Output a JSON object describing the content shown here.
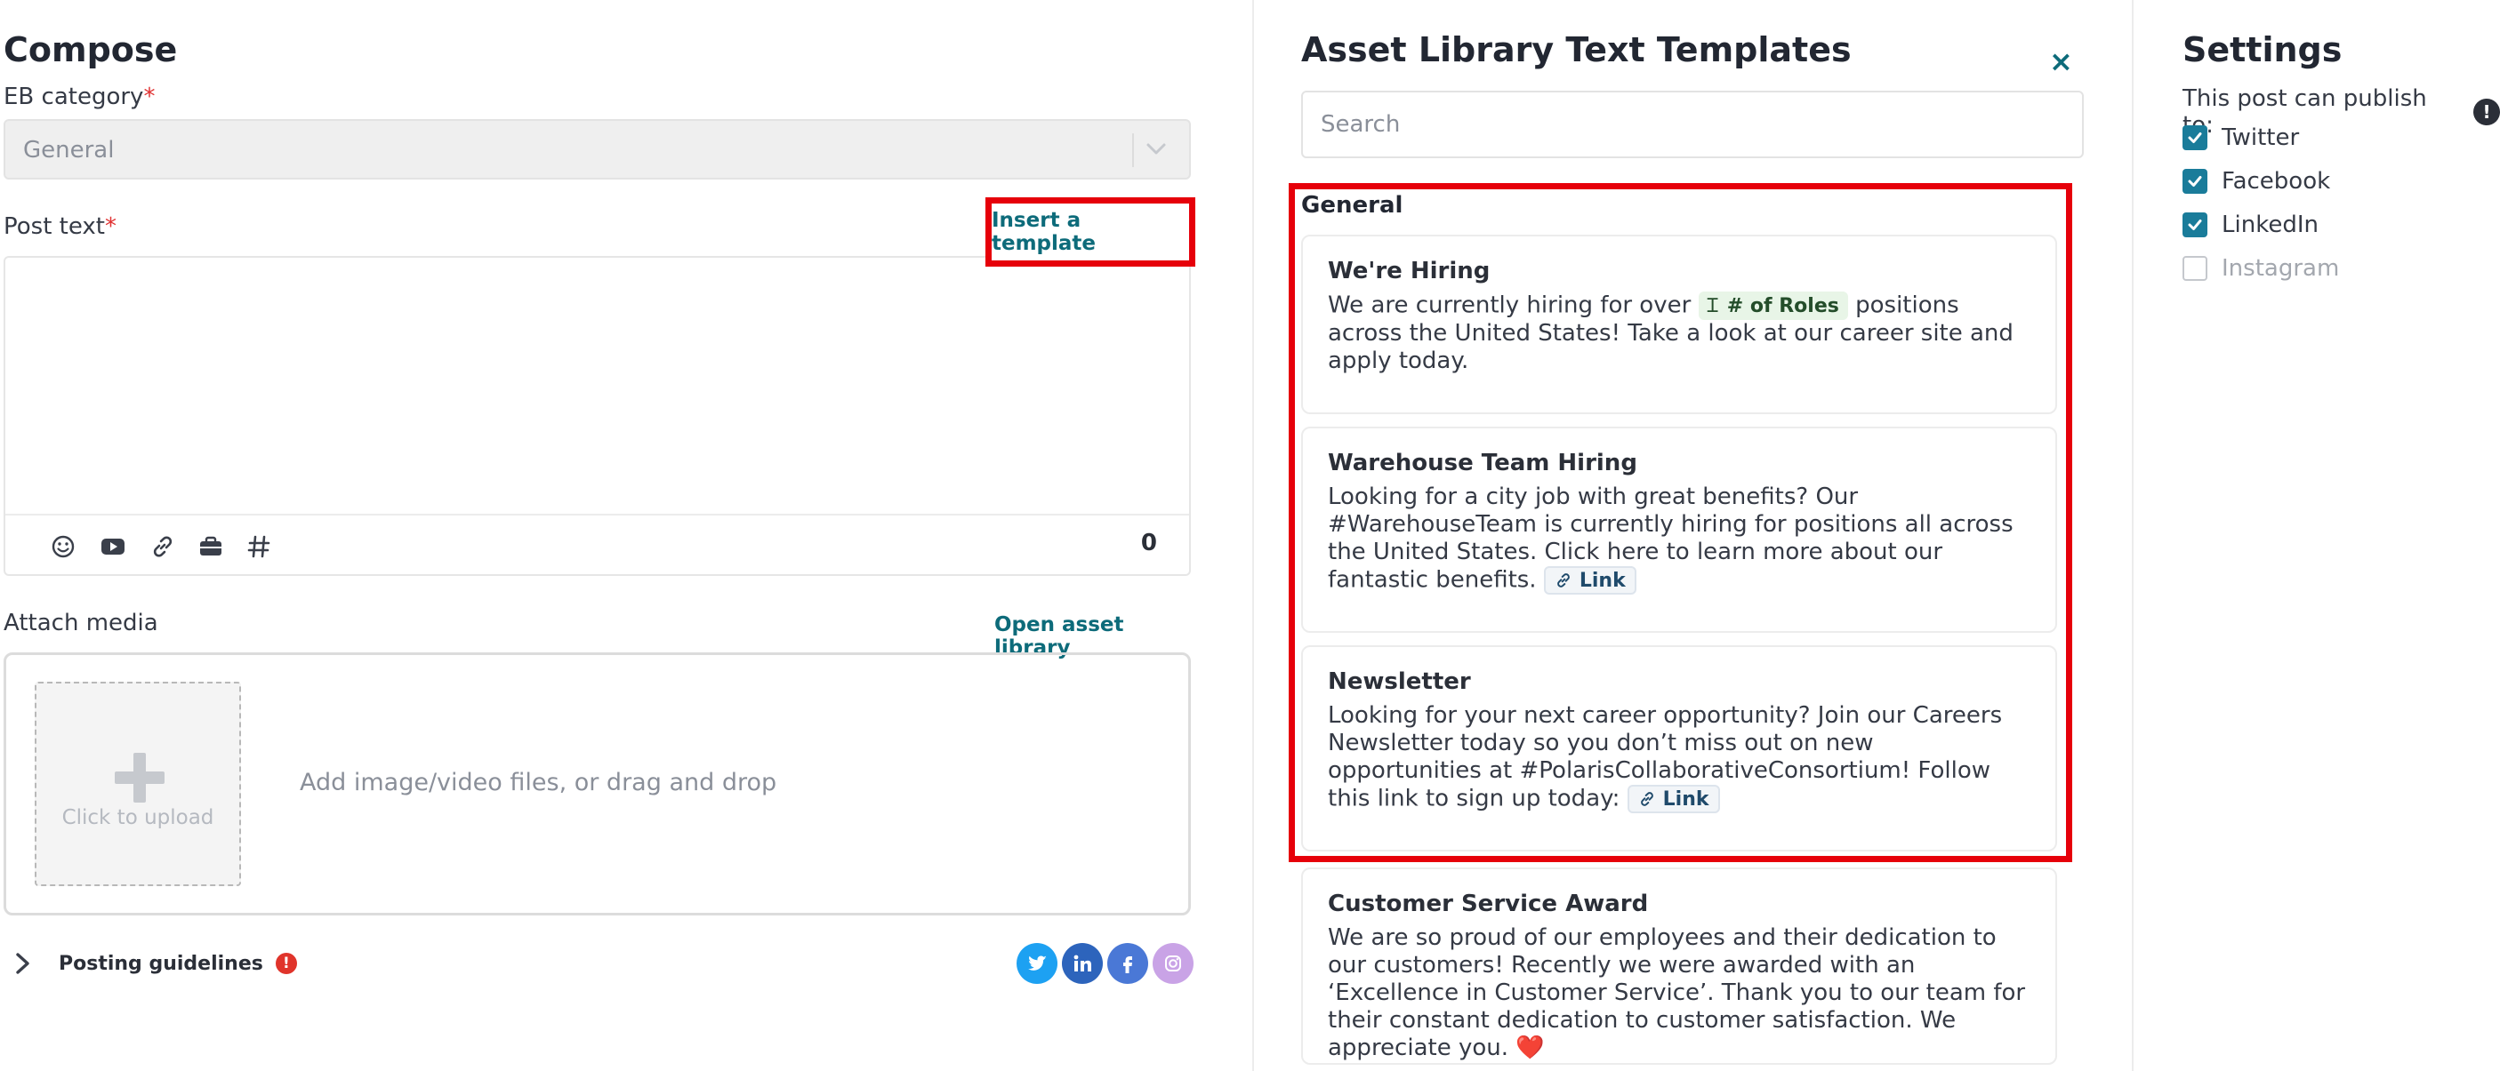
{
  "compose": {
    "title": "Compose",
    "eb_category_label": "EB category",
    "required_mark": "*",
    "eb_category_value": "General",
    "post_text_label": "Post text",
    "insert_template": "Insert a template",
    "char_count": "0",
    "toolbar_icons": [
      "emoji-icon",
      "youtube-icon",
      "link-icon",
      "briefcase-icon",
      "hashtag-icon"
    ],
    "attach_media_label": "Attach media",
    "open_asset_library": "Open asset library",
    "click_to_upload": "Click to upload",
    "dropzone_text": "Add image/video files, or drag and drop",
    "posting_guidelines": "Posting guidelines",
    "guidelines_alert": "!",
    "social_icons": [
      {
        "name": "twitter-icon",
        "color": "#1da1f2"
      },
      {
        "name": "linkedin-icon",
        "color": "#2d64bc"
      },
      {
        "name": "facebook-icon",
        "color": "#4a78d6"
      },
      {
        "name": "instagram-icon",
        "color": "#c9a3e6"
      }
    ]
  },
  "templates": {
    "title": "Asset Library Text Templates",
    "close": "×",
    "search_placeholder": "Search",
    "group": "General",
    "cards": [
      {
        "title": "We're Hiring",
        "body_before": "We are currently hiring for over",
        "chip": "# of Roles",
        "body_after": "positions across the United States! Take a look at our career site and apply today."
      },
      {
        "title": "Warehouse Team Hiring",
        "body_before": "Looking for a city job with great benefits? Our #WarehouseTeam is currently hiring for positions all across the United States. Click here to learn more about our fantastic benefits.",
        "link": "Link"
      },
      {
        "title": "Newsletter",
        "body_before": "Looking for your next career opportunity? Join our Careers Newsletter today so you don’t miss out on new opportunities at #PolarisCollaborativeConsortium! Follow this link to sign up today:",
        "link": "Link"
      },
      {
        "title": "Customer Service Award",
        "body_before": "We are so proud of our employees and their dedication to our customers! Recently we were awarded with an ‘Excellence in Customer Service’. Thank you to our team for their constant dedication to customer satisfaction. We appreciate you.",
        "emoji": "❤️"
      }
    ]
  },
  "settings": {
    "title": "Settings",
    "subtitle": "This post can publish to:",
    "info": "!",
    "platforms": [
      {
        "label": "Twitter",
        "checked": true
      },
      {
        "label": "Facebook",
        "checked": true
      },
      {
        "label": "LinkedIn",
        "checked": true
      },
      {
        "label": "Instagram",
        "checked": false
      }
    ]
  },
  "colors": {
    "accent": "#0d6b7a",
    "highlight": "#e6000a",
    "checkbox": "#1a7c9a"
  }
}
